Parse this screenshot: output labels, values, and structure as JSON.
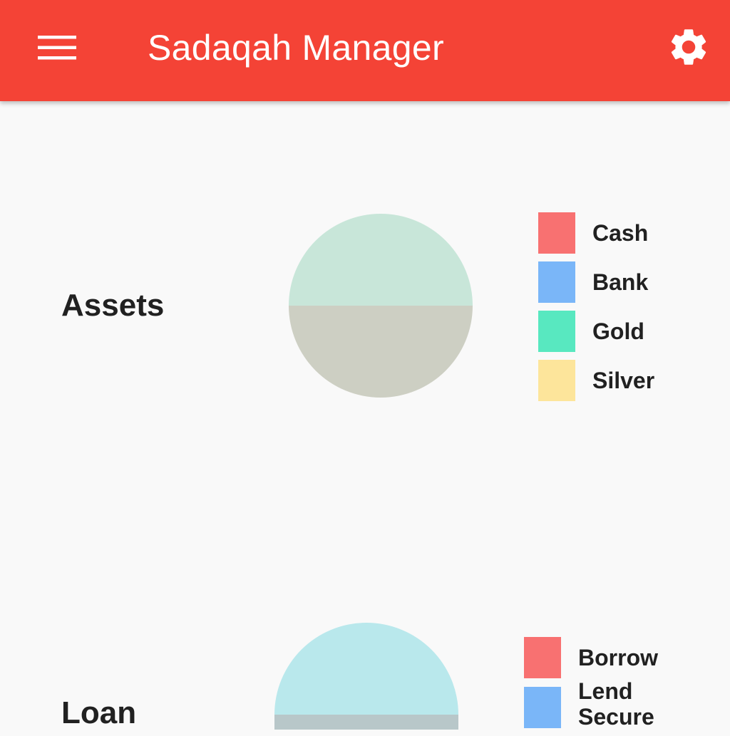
{
  "app_bar": {
    "title": "Sadaqah Manager",
    "color": "#f44336",
    "menu_icon": "hamburger-menu-icon",
    "settings_icon": "gear-icon"
  },
  "sections": [
    {
      "label": "Assets",
      "legend": [
        {
          "label": "Cash",
          "color": "#f87171"
        },
        {
          "label": "Bank",
          "color": "#7ab6f8"
        },
        {
          "label": "Gold",
          "color": "#58e8c0"
        },
        {
          "label": "Silver",
          "color": "#fde59b"
        }
      ],
      "pie_fills": [
        "#c8e6d9",
        "#cdcfc3"
      ]
    },
    {
      "label": "Loan",
      "legend": [
        {
          "label": "Borrow",
          "color": "#f87171"
        },
        {
          "label": "Lend Secure",
          "color": "#7ab6f8"
        }
      ],
      "pie_fills": [
        "#b9e8ec",
        "#b8c7c9"
      ]
    }
  ]
}
